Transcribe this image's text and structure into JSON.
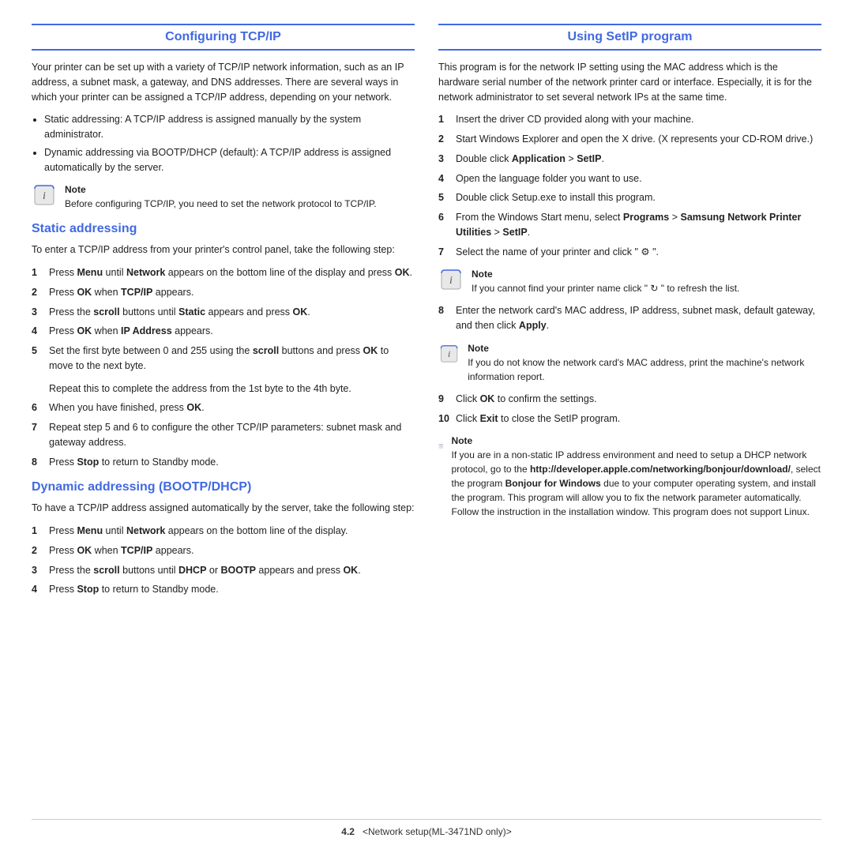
{
  "left": {
    "header": "Configuring TCP/IP",
    "intro": "Your printer can be set up with a variety of TCP/IP network information, such as an IP address, a subnet mask, a gateway, and DNS addresses. There are several ways in which your printer can be assigned a TCP/IP address, depending on your network.",
    "bullets": [
      "Static addressing: A TCP/IP address is assigned manually by the system administrator.",
      "Dynamic addressing via BOOTP/DHCP (default): A TCP/IP address is assigned automatically by the server."
    ],
    "note_label": "Note",
    "note_text": "Before configuring TCP/IP, you need to set the network protocol to TCP/IP.",
    "static_title": "Static addressing",
    "static_intro": "To enter a TCP/IP address from your printer's control panel, take the following step:",
    "static_steps": [
      {
        "num": "1",
        "text": "Press Menu until Network appears on the bottom line of the display and press OK."
      },
      {
        "num": "2",
        "text": "Press OK when TCP/IP appears."
      },
      {
        "num": "3",
        "text": "Press the scroll buttons until Static appears and press OK."
      },
      {
        "num": "4",
        "text": "Press OK when IP Address appears."
      },
      {
        "num": "5",
        "text": "Set the first byte between 0 and 255 using the scroll buttons and press OK to move to the next byte."
      }
    ],
    "static_indent": "Repeat this to complete the address from the 1st byte to the 4th byte.",
    "static_steps2": [
      {
        "num": "6",
        "text": "When you have finished, press OK."
      },
      {
        "num": "7",
        "text": "Repeat step 5 and 6 to configure the other TCP/IP parameters: subnet mask and gateway address."
      },
      {
        "num": "8",
        "text": "Press Stop to return to Standby mode."
      }
    ],
    "dynamic_title": "Dynamic addressing (BOOTP/DHCP)",
    "dynamic_intro": "To have a TCP/IP address assigned automatically by the server, take the following step:",
    "dynamic_steps": [
      {
        "num": "1",
        "text": "Press Menu until Network appears on the bottom line of the display."
      },
      {
        "num": "2",
        "text": "Press OK when TCP/IP appears."
      },
      {
        "num": "3",
        "text": "Press the scroll buttons until DHCP or BOOTP appears and press OK."
      },
      {
        "num": "4",
        "text": "Press Stop to return to Standby mode."
      }
    ]
  },
  "right": {
    "header": "Using SetIP program",
    "intro": "This program is for the network IP setting using the MAC address which is the hardware serial number of the network printer card or interface. Especially, it is for the network administrator to set several network IPs at the same time.",
    "steps": [
      {
        "num": "1",
        "text": "Insert the driver CD provided along with your machine."
      },
      {
        "num": "2",
        "text": "Start Windows Explorer and open the X drive. (X represents your CD-ROM drive.)"
      },
      {
        "num": "3",
        "text_parts": [
          "Double click ",
          "Application",
          " > ",
          "SetIP",
          "."
        ],
        "bold": [
          1,
          3
        ]
      },
      {
        "num": "4",
        "text": "Open the language folder you want to use."
      },
      {
        "num": "5",
        "text": "Double click Setup.exe to install this program."
      },
      {
        "num": "6",
        "text_parts": [
          "From the Windows Start menu, select ",
          "Programs",
          " > ",
          "Samsung Network Printer Utilities",
          " > ",
          "SetIP",
          "."
        ],
        "bold": [
          1,
          3,
          5
        ]
      },
      {
        "num": "7",
        "text_parts": [
          "Select the name of your printer and click \" ⚙ \"."
        ]
      }
    ],
    "note1_label": "Note",
    "note1_text": "If you cannot find your printer name click \" ↺ \" to refresh the list.",
    "steps2": [
      {
        "num": "8",
        "text": "Enter the network card's MAC address, IP address, subnet mask, default gateway, and then click Apply."
      }
    ],
    "note2_label": "Note",
    "note2_text": "If you do not know the network card's MAC address, print the machine's network information report.",
    "steps3": [
      {
        "num": "9",
        "text": "Click OK to confirm the settings."
      },
      {
        "num": "10",
        "text": "Click Exit to close the SetIP program."
      }
    ],
    "note3_label": "Note",
    "note3_text_parts": [
      "If you are in a non-static IP address environment and need to setup a DHCP network protocol, go to the http://developer.apple.com/networking/bonjour/download/, select the program Bonjour for Windows due to your computer operating system, and install the program. This program will allow you to fix the network parameter automatically. Follow the instruction in the installation window. This program does not support Linux."
    ]
  },
  "footer": {
    "page": "4.2",
    "subtitle": "<Network setup(ML-3471ND only)>"
  }
}
